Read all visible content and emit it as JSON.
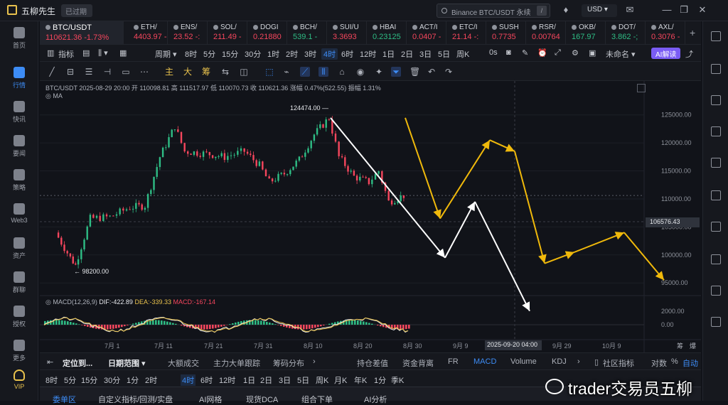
{
  "app": {
    "name": "五柳先生",
    "expired": "已过期"
  },
  "search": {
    "placeholder": "Binance BTC/USDT 永续",
    "shortcut": "/"
  },
  "header": {
    "currency": "USD"
  },
  "nav": [
    {
      "label": "首页"
    },
    {
      "label": "行情"
    },
    {
      "label": "快讯"
    },
    {
      "label": "要闻"
    },
    {
      "label": "策略"
    },
    {
      "label": "Web3"
    },
    {
      "label": "资产"
    },
    {
      "label": "群聊"
    },
    {
      "label": "授权"
    },
    {
      "label": "更多"
    },
    {
      "label": "VIP"
    }
  ],
  "tickers": [
    {
      "symbol": "BTC/USDT",
      "price": "110621.36",
      "change": "-1.73%",
      "dir": "down"
    },
    {
      "symbol": "ETH/",
      "price": "4403.97",
      "change": "-",
      "dir": "down"
    },
    {
      "symbol": "ENS/",
      "price": "23.52",
      "change": "-:",
      "dir": "down"
    },
    {
      "symbol": "SOL/",
      "price": "211.49",
      "change": "-",
      "dir": "down"
    },
    {
      "symbol": "DOGI",
      "price": "0.21880",
      "change": "",
      "dir": "down"
    },
    {
      "symbol": "BCH/",
      "price": "539.1",
      "change": "-",
      "dir": "up"
    },
    {
      "symbol": "SUI/U",
      "price": "3.3693",
      "change": "",
      "dir": "down"
    },
    {
      "symbol": "HBAI",
      "price": "0.23125",
      "change": "",
      "dir": "up"
    },
    {
      "symbol": "ACT/I",
      "price": "0.0407",
      "change": "-",
      "dir": "down"
    },
    {
      "symbol": "ETC/I",
      "price": "21.14",
      "change": "-:",
      "dir": "down"
    },
    {
      "symbol": "SUSH",
      "price": "0.7735",
      "change": "",
      "dir": "down"
    },
    {
      "symbol": "RSR/",
      "price": "0.00764",
      "change": "",
      "dir": "down"
    },
    {
      "symbol": "OKB/",
      "price": "167.97",
      "change": "",
      "dir": "up"
    },
    {
      "symbol": "DOT/",
      "price": "3.862",
      "change": "-;",
      "dir": "up"
    },
    {
      "symbol": "AXL/",
      "price": "0.3076",
      "change": "-",
      "dir": "down"
    }
  ],
  "toolbar1": {
    "indicator": "指标",
    "period": "周期",
    "timeframes": [
      "8时",
      "5分",
      "15分",
      "30分",
      "1时",
      "2时",
      "3时",
      "4时",
      "6时",
      "12时",
      "1日",
      "2日",
      "3日",
      "5日",
      "周K"
    ],
    "selected_tf": "4时",
    "secs": "0s",
    "unnamed": "未命名",
    "ai": "AI解读"
  },
  "toolbar2": {
    "main": "主",
    "big": "大",
    "chip": "筹"
  },
  "chart": {
    "legend_title": "BTC/USDT  2025-08-29 20:00  开 110098.81  高 111517.97  低 110070.73  收 110621.36  涨幅 0.47%(522.55)  振幅 1.31%",
    "ma": "MA",
    "high_label": "124474.00 —",
    "low_label": "← 98200.00",
    "macd_legend": "MACD(12,26,9)",
    "dif": "DIF:-422.89",
    "dea": "DEA:-339.33",
    "macd": "MACD:-167.14",
    "price_axis": [
      "125000.00",
      "120000.00",
      "115000.00",
      "110000.00",
      "105000.00",
      "100000.00",
      "95000.00"
    ],
    "current_price": "106576.43",
    "macd_axis": [
      "2000.00",
      "0.00"
    ],
    "time_axis": [
      "7月 1",
      "7月 11",
      "7月 21",
      "7月 31",
      "8月 10",
      "8月 20",
      "8月 30",
      "9月 9",
      "9月 29",
      "10月 9"
    ],
    "crosshair_time": "2025-09-20 04:00",
    "corner_a": "筹",
    "corner_b": "爆"
  },
  "chart_data": {
    "type": "candlestick",
    "title": "BTC/USDT 4H",
    "ohlc_last": {
      "open": 110098.81,
      "high": 111517.97,
      "low": 110070.73,
      "close": 110621.36
    },
    "swing_high": 124474.0,
    "swing_low": 98200.0,
    "ylim": [
      93000,
      127500
    ],
    "anchor_closes": [
      [
        "6/20",
        104000
      ],
      [
        "6/23",
        99500
      ],
      [
        "6/24",
        98200
      ],
      [
        "6/27",
        106500
      ],
      [
        "7/1",
        106800
      ],
      [
        "7/5",
        108500
      ],
      [
        "7/8",
        108800
      ],
      [
        "7/11",
        117500
      ],
      [
        "7/14",
        123000
      ],
      [
        "7/16",
        118500
      ],
      [
        "7/21",
        118000
      ],
      [
        "7/24",
        117500
      ],
      [
        "7/28",
        118500
      ],
      [
        "7/31",
        116000
      ],
      [
        "8/2",
        113000
      ],
      [
        "8/5",
        114500
      ],
      [
        "8/8",
        117000
      ],
      [
        "8/11",
        121500
      ],
      [
        "8/14",
        124474
      ],
      [
        "8/16",
        117500
      ],
      [
        "8/19",
        114000
      ],
      [
        "8/22",
        113000
      ],
      [
        "8/24",
        115000
      ],
      [
        "8/26",
        109500
      ],
      [
        "8/29",
        110621
      ]
    ],
    "projection_yellow": [
      [
        "8/29",
        124474
      ],
      [
        "9/5",
        106500
      ],
      [
        "9/15",
        120500
      ],
      [
        "9/20",
        118500
      ],
      [
        "9/26",
        98500
      ],
      [
        "10/2",
        100500
      ],
      [
        "10/12",
        104000
      ],
      [
        "10/20",
        95500
      ]
    ],
    "projection_white": [
      [
        "8/14",
        124474
      ],
      [
        "9/6",
        99500
      ],
      [
        "9/12",
        109500
      ],
      [
        "9/23",
        90000
      ]
    ],
    "macd": {
      "dif": -422.89,
      "dea": -339.33,
      "hist": -167.14
    }
  },
  "bottom1": {
    "locate": "定位到...",
    "date_range": "日期范围",
    "tabs": [
      "大额成交",
      "主力大单跟踪",
      "筹码分布",
      "持仓差值",
      "资金背离",
      "FR",
      "MACD",
      "Volume",
      "KDJ"
    ],
    "active_tab": "MACD",
    "community": "社区指标",
    "log": "对数",
    "pct": "%",
    "auto": "自动"
  },
  "bottom2": {
    "tfs": [
      "8时",
      "5分",
      "15分",
      "30分",
      "1分",
      "2时",
      "4时",
      "6时",
      "12时",
      "1日",
      "2日",
      "3日",
      "5日",
      "周K",
      "月K",
      "年K",
      "1分",
      "季K"
    ],
    "selected": "4时"
  },
  "bottom3": {
    "tabs": [
      "委单区",
      "自定义指标/回测/实盘",
      "AI网格",
      "现货DCA",
      "组合下单",
      "AI分析"
    ]
  },
  "watermark": {
    "text": "trader交易员五柳"
  },
  "colors": {
    "accent": "#3d8cf5",
    "up": "#2ebd85",
    "down": "#f6465d",
    "projection": "#f0b90b"
  }
}
